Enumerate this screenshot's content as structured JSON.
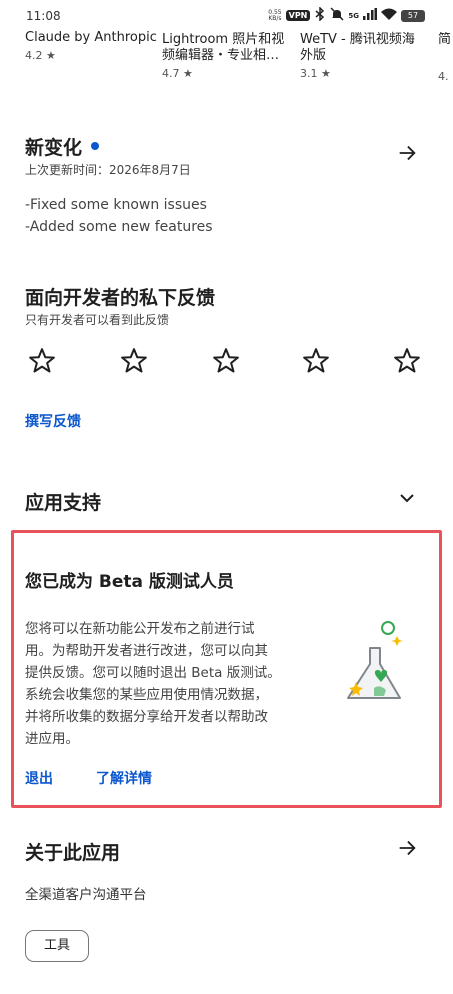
{
  "status": {
    "time": "11:08",
    "net_speed_value": "0.55",
    "net_speed_unit": "KB/s",
    "vpn": "VPN",
    "network": "5G",
    "battery": "57"
  },
  "related_apps": [
    {
      "name": "Claude by Anthropic",
      "rating": "4.2"
    },
    {
      "name": "Lightroom 照片和视\n频编辑器・专业相…",
      "rating": "4.7"
    },
    {
      "name": "WeTV - 腾讯视频海\n外版",
      "rating": "3.1"
    },
    {
      "name": "简",
      "rating": "4."
    }
  ],
  "whats_new": {
    "title": "新变化",
    "updated": "上次更新时间：2026年8月7日",
    "notes": [
      "-Fixed some known issues",
      "-Added some new features"
    ]
  },
  "private_feedback": {
    "title": "面向开发者的私下反馈",
    "subtitle": "只有开发者可以看到此反馈",
    "stars": 5,
    "rating_value": 0,
    "write_link": "撰写反馈"
  },
  "app_support": {
    "title": "应用支持"
  },
  "beta": {
    "title": "您已成为 Beta 版测试人员",
    "lines": [
      "您将可以在新功能公开发布之前进行试",
      "用。为帮助开发者进行改进，您可以向其",
      "提供反馈。您可以随时退出 Beta 版测试。",
      "系统会收集您的某些应用使用情况数据，",
      "并将所收集的数据分享给开发者以帮助改",
      "进应用。"
    ],
    "leave": "退出",
    "learn_more": "了解详情"
  },
  "about": {
    "title": "关于此应用",
    "description": "全渠道客户沟通平台",
    "chip": "工具"
  },
  "colors": {
    "accent": "#0b57d0",
    "highlight_border": "#e8525a"
  }
}
